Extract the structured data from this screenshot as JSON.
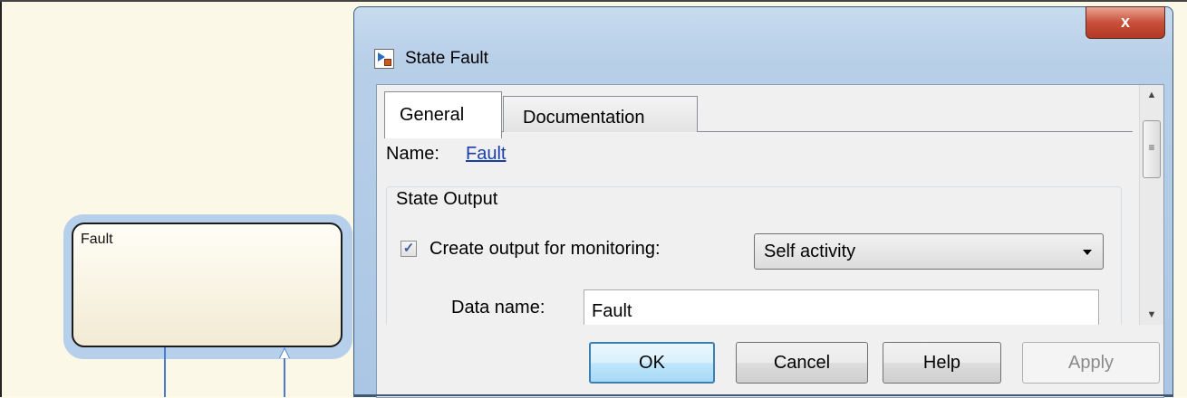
{
  "canvas": {
    "state": {
      "label": "Fault"
    }
  },
  "dialog": {
    "title": "State Fault",
    "close_label": "x",
    "tabs": [
      {
        "label": "General",
        "selected": true
      },
      {
        "label": "Documentation",
        "selected": false
      }
    ],
    "name_label": "Name:",
    "name_value": "Fault",
    "state_output": {
      "group_title": "State Output",
      "checkbox_checked": true,
      "checkbox_label": "Create output for monitoring:",
      "select_value": "Self activity",
      "data_name_label": "Data name:",
      "data_name_value": "Fault"
    },
    "buttons": {
      "ok": "OK",
      "cancel": "Cancel",
      "help": "Help",
      "apply": "Apply"
    }
  },
  "colors": {
    "canvas_bg": "#fcf8e8",
    "selection_halo": "#a9c8ea",
    "transition": "#4a7bd0",
    "link": "#1a3ea8"
  }
}
